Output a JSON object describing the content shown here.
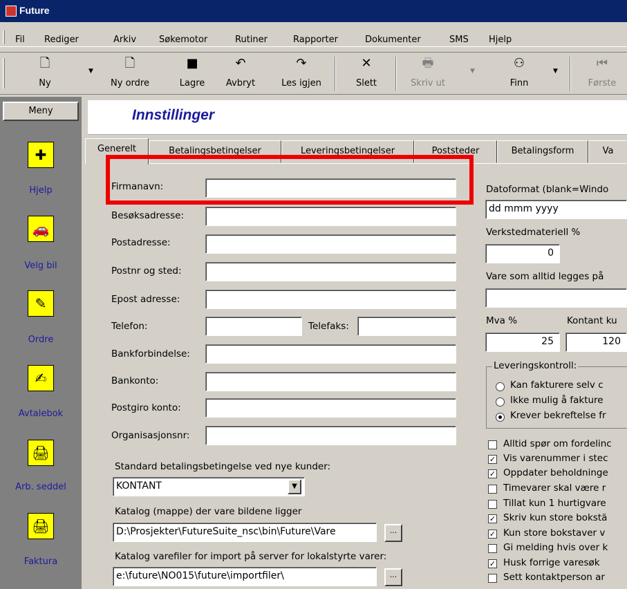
{
  "window": {
    "title": "Future"
  },
  "menu": [
    "Fil",
    "Rediger",
    "Arkiv",
    "Søkemotor",
    "Rutiner",
    "Rapporter",
    "Dokumenter",
    "SMS",
    "Hjelp"
  ],
  "toolbar": {
    "ny": "Ny",
    "ny_ordre": "Ny ordre",
    "lagre": "Lagre",
    "avbryt": "Avbryt",
    "les_igjen": "Les igjen",
    "slett": "Slett",
    "skriv_ut": "Skriv ut",
    "finn": "Finn",
    "forste": "Første"
  },
  "sidebar": {
    "meny": "Meny",
    "items": [
      "Hjelp",
      "Velg bil",
      "Ordre",
      "Avtalebok",
      "Arb. seddel",
      "Faktura"
    ]
  },
  "header": {
    "title": "Innstillinger"
  },
  "tabs": [
    "Generelt",
    "Betalingsbetingelser",
    "Leveringsbetingelser",
    "Poststeder",
    "Betalingsform",
    "Va"
  ],
  "form": {
    "firmanavn": "Firmanavn:",
    "besoksadresse": "Besøksadresse:",
    "postadresse": "Postadresse:",
    "postnr_sted": "Postnr og sted:",
    "epost": "Epost adresse:",
    "telefon": "Telefon:",
    "telefaks": "Telefaks:",
    "bankforbindelse": "Bankforbindelse:",
    "bankkonto": "Bankonto:",
    "postgiro": "Postgiro konto:",
    "orgnr": "Organisasjonsnr:",
    "std_betaling_label": "Standard betalingsbetingelse ved nye kunder:",
    "std_betaling_value": "KONTANT",
    "katalog_bilder_label": "Katalog (mappe) der vare bildene ligger",
    "katalog_bilder_value": "D:\\Prosjekter\\FutureSuite_nsc\\bin\\Future\\Vare",
    "katalog_import_label": "Katalog varefiler for import på server for lokalstyrte varer:",
    "katalog_import_value": "e:\\future\\NO015\\future\\importfiler\\",
    "dots": "..."
  },
  "right": {
    "datoformat_label": "Datoformat (blank=Windo",
    "datoformat_value": "dd mmm yyyy",
    "verksted_label": "Verkstedmateriell %",
    "verksted_value": "0",
    "vare_label": "Vare som alltid legges på",
    "mva_label": "Mva %",
    "mva_value": "25",
    "kontant_label": "Kontant ku",
    "kontant_value": "120",
    "levering_group": "Leveringskontroll:",
    "radios": [
      {
        "label": "Kan fakturere selv c",
        "on": false
      },
      {
        "label": "Ikke mulig å fakture",
        "on": false
      },
      {
        "label": "Krever bekreftelse fr",
        "on": true
      }
    ],
    "checks": [
      {
        "label": "Alltid spør om fordelinc",
        "on": false
      },
      {
        "label": "Vis varenummer i stec",
        "on": true
      },
      {
        "label": "Oppdater beholdninge",
        "on": true
      },
      {
        "label": "Timevarer skal være r",
        "on": false
      },
      {
        "label": "Tillat kun 1 hurtigvare",
        "on": false
      },
      {
        "label": "Skriv kun store bokstä",
        "on": true
      },
      {
        "label": "Kun store bokstaver v",
        "on": true
      },
      {
        "label": "Gi melding hvis over k",
        "on": false
      },
      {
        "label": "Husk forrige varesøk",
        "on": true
      },
      {
        "label": "Sett kontaktperson ar",
        "on": false
      }
    ]
  }
}
